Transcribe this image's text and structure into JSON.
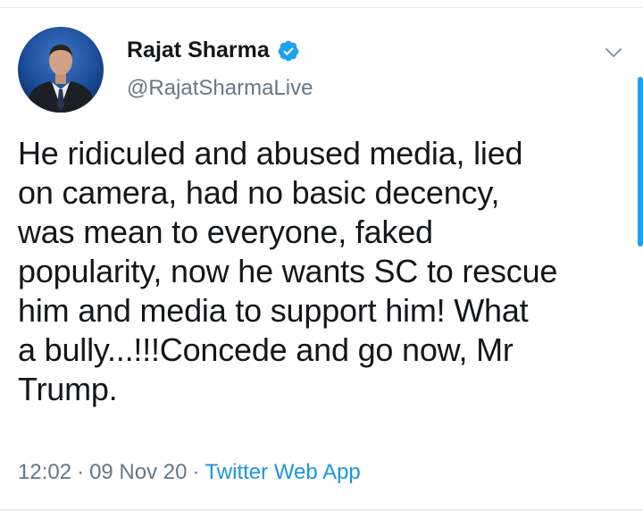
{
  "tweet": {
    "author": {
      "name": "Rajat Sharma",
      "handle": "@RajatSharmaLive",
      "verified": true,
      "avatar_icon": "profile-photo"
    },
    "text": "He ridiculed and abused media, lied\non camera, had no basic decency,\nwas mean to everyone, faked\npopularity, now he wants SC to rescue\nhim and media to support him! What\na bully...!!!Concede and go now, Mr\nTrump.",
    "time": "12:02",
    "date": "09 Nov 20",
    "separator": "·",
    "source": "Twitter Web App",
    "menu_icon": "chevron-down-icon"
  },
  "colors": {
    "text": "#14171a",
    "secondary": "#657786",
    "link": "#1b95e0",
    "verified_badge": "#1da1f2",
    "divider": "#e6ecf0"
  }
}
